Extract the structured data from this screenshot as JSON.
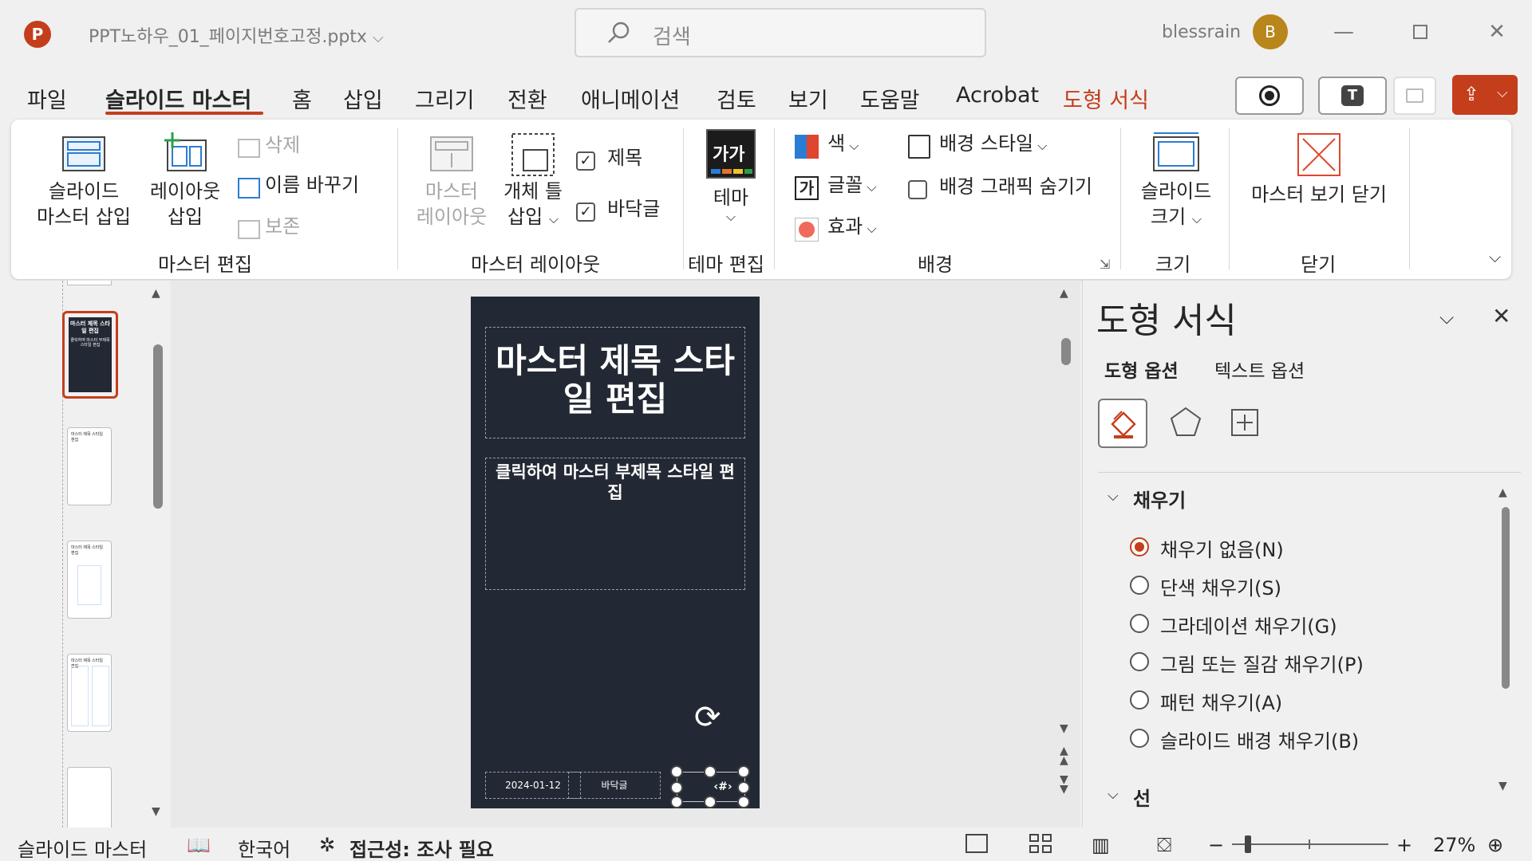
{
  "app": {
    "logo": "P",
    "file_title": "PPT노하우_01_페이지번호고정.pptx",
    "user_name": "blessrain",
    "avatar_initial": "B"
  },
  "search": {
    "placeholder": "검색"
  },
  "tabs": [
    {
      "label": "파일"
    },
    {
      "label": "슬라이드 마스터"
    },
    {
      "label": "홈"
    },
    {
      "label": "삽입"
    },
    {
      "label": "그리기"
    },
    {
      "label": "전환"
    },
    {
      "label": "애니메이션"
    },
    {
      "label": "검토"
    },
    {
      "label": "보기"
    },
    {
      "label": "도움말"
    },
    {
      "label": "Acrobat"
    },
    {
      "label": "도형 서식"
    }
  ],
  "ribbon": {
    "master_edit": {
      "insert_master": [
        "슬라이드",
        "마스터 삽입"
      ],
      "insert_layout": [
        "레이아웃",
        "삽입"
      ],
      "delete": "삭제",
      "rename": "이름 바꾸기",
      "preserve": "보존",
      "group": "마스터 편집"
    },
    "master_layout": {
      "master_layout": [
        "마스터",
        "레이아웃"
      ],
      "insert_placeholder": [
        "개체 틀",
        "삽입"
      ],
      "title_check": "제목",
      "footer_check": "바닥글",
      "group": "마스터 레이아웃"
    },
    "theme_edit": {
      "theme": "테마",
      "theme_icon_text": "가가",
      "group": "테마 편집"
    },
    "background": {
      "colors": "색",
      "fonts": "글꼴",
      "fonts_icon_text": "가",
      "effects": "효과",
      "bg_styles": "배경 스타일",
      "hide_bg_graphics": "배경 그래픽 숨기기",
      "group": "배경"
    },
    "size": {
      "slide_size": [
        "슬라이드",
        "크기"
      ],
      "group": "크기"
    },
    "close": {
      "close_master": "마스터 보기 닫기",
      "group": "닫기"
    }
  },
  "slide": {
    "title": "마스터 제목 스타일 편집",
    "subtitle": "클릭하여 마스터 부제목 스타일 편집",
    "date": "2024-01-12",
    "footer": "바닥글",
    "page_number": "‹#›"
  },
  "thumbnails": {
    "active_title": "마스터 제목 스타 일 편집",
    "active_sub": "클릭하여 마스터 부제목 스타일 편집",
    "small_title": "마스터 제목 스타일 편집"
  },
  "format_pane": {
    "title": "도형 서식",
    "tab_shape": "도형 옵션",
    "tab_text": "텍스트 옵션",
    "fill_section": "채우기",
    "line_section": "선",
    "options": [
      {
        "label": "채우기 없음(N)",
        "selected": true
      },
      {
        "label": "단색 채우기(S)",
        "selected": false
      },
      {
        "label": "그라데이션 채우기(G)",
        "selected": false
      },
      {
        "label": "그림 또는 질감 채우기(P)",
        "selected": false
      },
      {
        "label": "패턴 채우기(A)",
        "selected": false
      },
      {
        "label": "슬라이드 배경 채우기(B)",
        "selected": false
      }
    ]
  },
  "status": {
    "view": "슬라이드 마스터",
    "language": "한국어",
    "accessibility": "접근성: 조사 필요",
    "zoom": "27%"
  },
  "colors": {
    "accent": "#c43e1c",
    "slide_bg": "#232934"
  }
}
